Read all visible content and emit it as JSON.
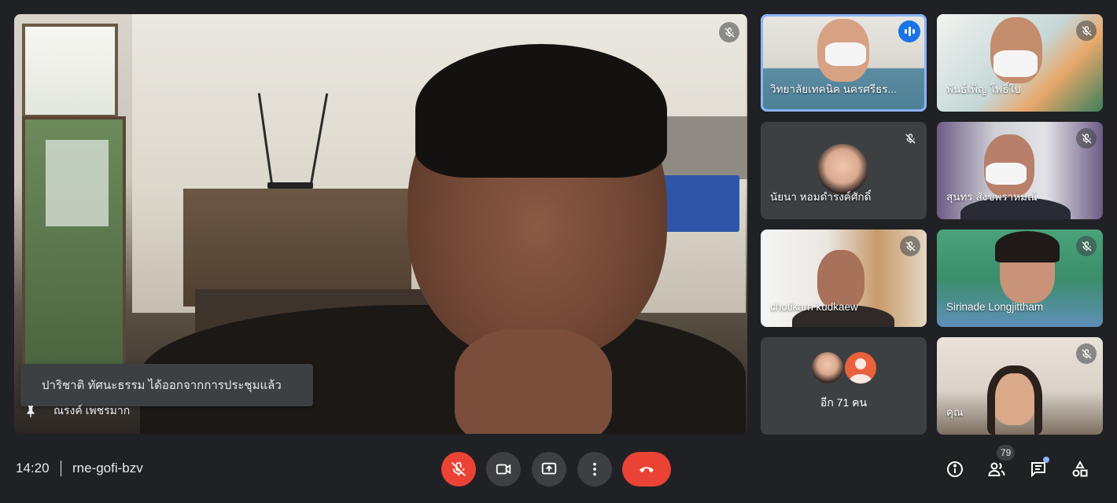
{
  "main_stage": {
    "presenter_name": "ณรงค์ เพชรมาก",
    "toast_message": "ปาริชาติ ทัศนะธรรม ได้ออกจากการประชุมแล้ว",
    "mic_muted": true
  },
  "participants": [
    {
      "name": "วิทยาลัยเทคนิค นครศรีธร...",
      "speaking": true,
      "mic_muted": false
    },
    {
      "name": "พันธ์เพ็ญ โพธิ์ใบ",
      "speaking": false,
      "mic_muted": true
    },
    {
      "name": "นัยนา หอมดำรงค์ศักดิ์",
      "speaking": false,
      "mic_muted": true
    },
    {
      "name": "สุนทร สังขพราหมณ์",
      "speaking": false,
      "mic_muted": true
    },
    {
      "name": "chotikarn kudkaew",
      "speaking": false,
      "mic_muted": true
    },
    {
      "name": "Sirinade Longjittham",
      "speaking": false,
      "mic_muted": true
    },
    {
      "name": "คุณ",
      "speaking": false,
      "mic_muted": true
    }
  ],
  "others": {
    "label": "อีก 71 คน"
  },
  "bottom_bar": {
    "time": "14:20",
    "meeting_code": "rne-gofi-bzv",
    "participant_count": "79",
    "controls": [
      "mic-off-icon",
      "camera-icon",
      "present-screen-icon",
      "more-options-icon",
      "hang-up-icon"
    ],
    "right_icons": [
      "info-icon",
      "people-icon",
      "chat-icon",
      "activities-icon"
    ]
  },
  "colors": {
    "background": "#202124",
    "tile": "#3c4043",
    "danger": "#ea4335",
    "accent": "#1a73e8",
    "speaking_outline": "#8ab4f8"
  }
}
